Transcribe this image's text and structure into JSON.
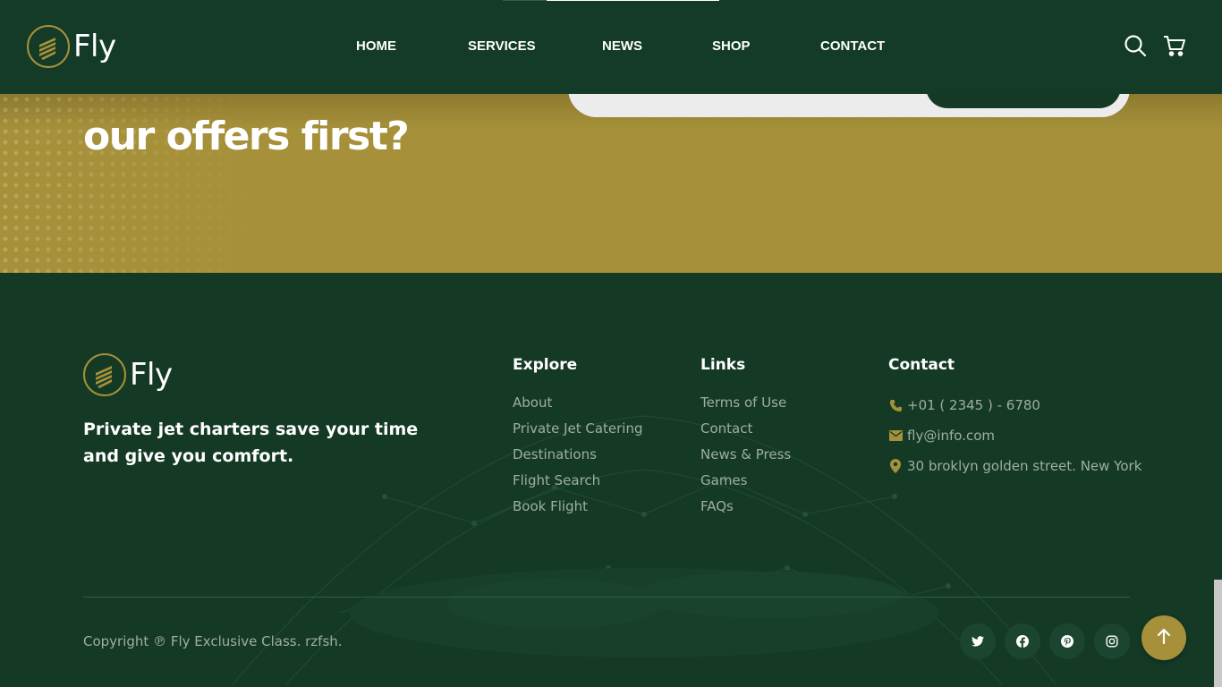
{
  "brand": {
    "name": "Fly",
    "accent": "#a6913a",
    "dark": "#143a26"
  },
  "nav": {
    "items": [
      {
        "label": "HOME"
      },
      {
        "label": "SERVICES"
      },
      {
        "label": "NEWS"
      },
      {
        "label": "SHOP"
      },
      {
        "label": "CONTACT"
      }
    ],
    "icons": [
      "search-icon",
      "cart-icon"
    ]
  },
  "newsletter": {
    "heading": "our offers first?"
  },
  "footer": {
    "tagline": "Private jet charters save your time and give you comfort.",
    "explore": {
      "title": "Explore",
      "links": [
        "About",
        "Private Jet Catering",
        "Destinations",
        "Flight Search",
        "Book Flight"
      ]
    },
    "links": {
      "title": "Links",
      "links": [
        "Terms of Use",
        "Contact",
        "News & Press",
        "Games",
        "FAQs"
      ]
    },
    "contact": {
      "title": "Contact",
      "phone": "+01 ( 2345 ) - 6780",
      "email": "fly@info.com",
      "address": "30 broklyn golden street. New York"
    },
    "copyright": "Copyright ℗ Fly Exclusive Class. rzfsh.",
    "socials": [
      "twitter-icon",
      "facebook-icon",
      "pinterest-icon",
      "instagram-icon"
    ]
  }
}
